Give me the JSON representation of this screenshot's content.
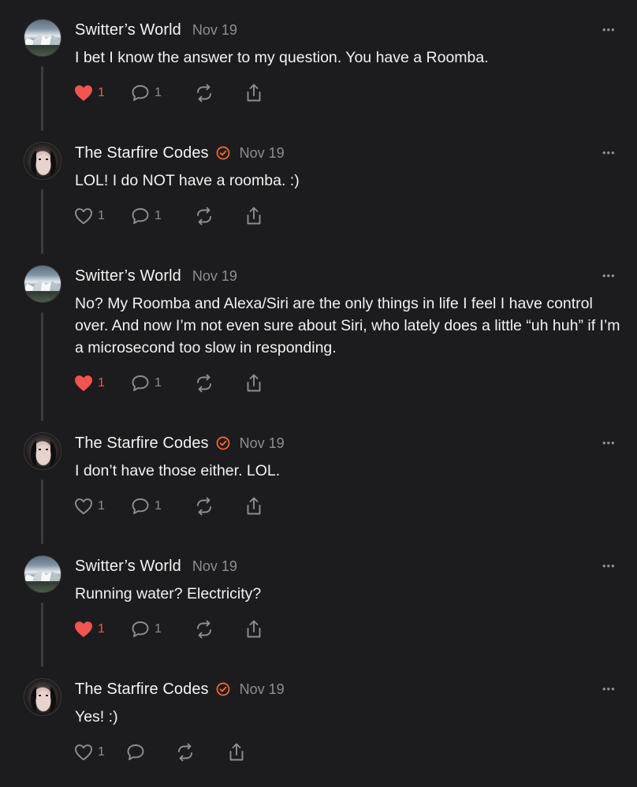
{
  "app": {
    "accent_like": "#f2554f",
    "accent_verified": "#ff6b2c"
  },
  "posts": [
    {
      "author": "Switter’s World",
      "avatar": "mountain-avatar",
      "verified": false,
      "date": "Nov 19",
      "text": "I bet I know the answer to my question. You have a Roomba.",
      "liked": true,
      "likes": "1",
      "replies": "1"
    },
    {
      "author": "The Starfire Codes",
      "avatar": "person-avatar",
      "verified": true,
      "date": "Nov 19",
      "text": "LOL! I do NOT have a roomba. :)",
      "liked": false,
      "likes": "1",
      "replies": "1"
    },
    {
      "author": "Switter’s World",
      "avatar": "mountain-avatar",
      "verified": false,
      "date": "Nov 19",
      "text": "No? My Roomba and Alexa/Siri are the only things in life I feel I have control over. And now I’m not even sure about Siri, who lately does a little “uh huh” if I’m a microsecond too slow in responding.",
      "liked": true,
      "likes": "1",
      "replies": "1"
    },
    {
      "author": "The Starfire Codes",
      "avatar": "person-avatar",
      "verified": true,
      "date": "Nov 19",
      "text": "I don’t have those either. LOL.",
      "liked": false,
      "likes": "1",
      "replies": "1"
    },
    {
      "author": "Switter’s World",
      "avatar": "mountain-avatar",
      "verified": false,
      "date": "Nov 19",
      "text": "Running water? Electricity?",
      "liked": true,
      "likes": "1",
      "replies": "1"
    },
    {
      "author": "The Starfire Codes",
      "avatar": "person-avatar",
      "verified": true,
      "date": "Nov 19",
      "text": "Yes! :)",
      "liked": false,
      "likes": "1",
      "replies": ""
    }
  ]
}
